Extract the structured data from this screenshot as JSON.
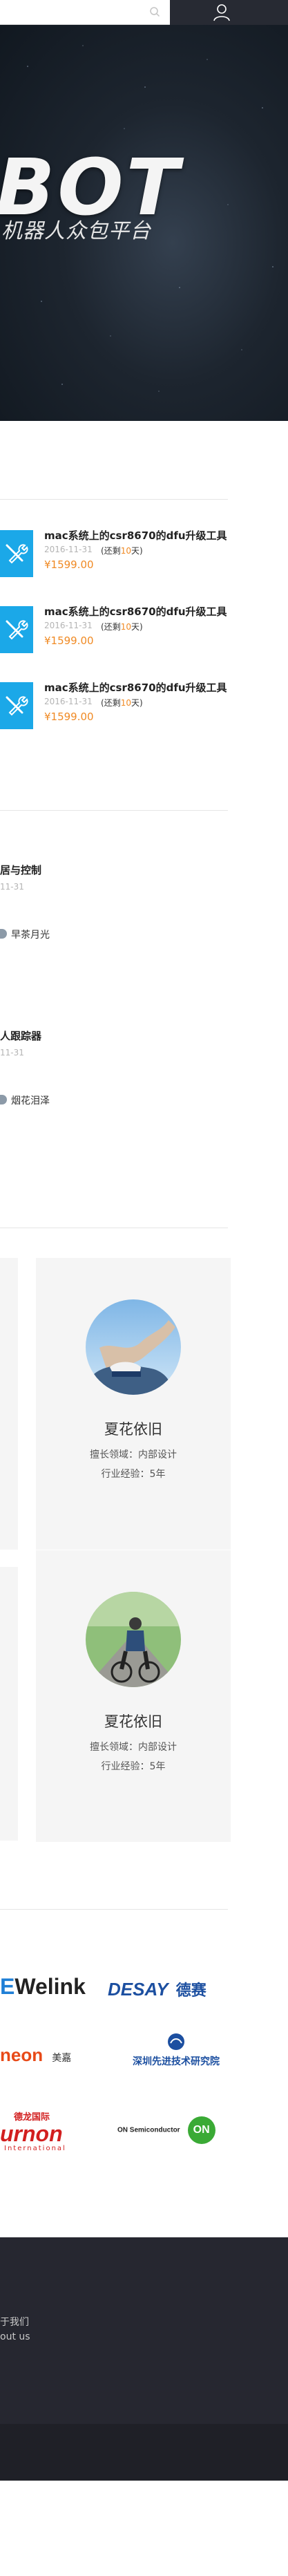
{
  "header": {
    "search": {
      "placeholder": "",
      "value": ""
    }
  },
  "hero": {
    "logo_text": "BOT",
    "subtitle": "机器人众包平台"
  },
  "tasks": [
    {
      "title": "mac系统上的csr8670的dfu升级工具",
      "date": "2016-11-31",
      "remain_prefix": "(还剩",
      "remain_days": "10",
      "remain_suffix": "天)",
      "price": "¥1599.00"
    },
    {
      "title": "mac系统上的csr8670的dfu升级工具",
      "date": "2016-11-31",
      "remain_prefix": "(还剩",
      "remain_days": "10",
      "remain_suffix": "天)",
      "price": "¥1599.00"
    },
    {
      "title": "mac系统上的csr8670的dfu升级工具",
      "date": "2016-11-31",
      "remain_prefix": "(还剩",
      "remain_days": "10",
      "remain_suffix": "天)",
      "price": "¥1599.00"
    }
  ],
  "projects": [
    {
      "title": "居与控制",
      "date": "11-31",
      "user": "早茶月光"
    },
    {
      "title": "人跟踪器",
      "date": "11-31",
      "user": "烟花泪泽"
    }
  ],
  "designers": [
    {
      "name": "夏花依旧",
      "field": "擅长领域：内部设计",
      "experience": "行业经验：5年"
    },
    {
      "name": "夏花依旧",
      "field": "擅长领域：内部设计",
      "experience": "行业经验：5年"
    }
  ],
  "partners": {
    "ewelink": "eWelink",
    "desay_en": "DESAY",
    "desay_cn": "德赛",
    "neon": "neon",
    "neon_cn": "美嘉",
    "siat": "深圳先进技术研究院",
    "durnon_cn": "德龙国际",
    "durnon": "urnon",
    "durnon_sub": "International",
    "onsemi": "ON Semiconductor",
    "onsemi_mark": "ON",
    "colors": {
      "ewelink_e": "#1f7fd6",
      "ewelink": "#222222",
      "desay": "#1c4fa0",
      "neon": "#e84a18",
      "durnon": "#d21f1f",
      "onsemi": "#3aaa35",
      "siat": "#1c4fa0"
    }
  },
  "footer": {
    "links": [
      "于我们",
      "out us"
    ]
  }
}
